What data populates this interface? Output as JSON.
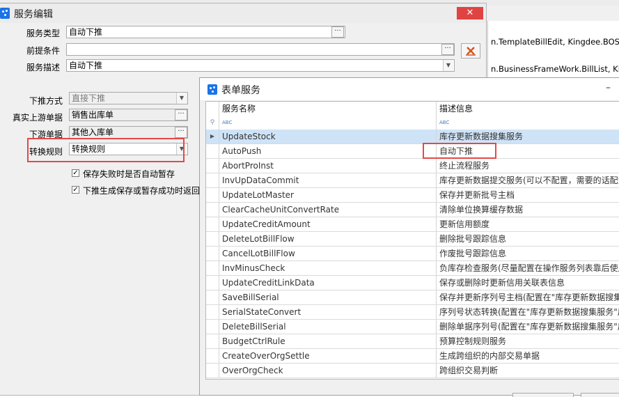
{
  "bg": {
    "line1": "n.TemplateBillEdit, Kingdee.BOS.Bu",
    "line2": "n.BusinessFrameWork.BillList, Kingd"
  },
  "service_edit": {
    "title": "服务编辑",
    "close_icon": "close-x",
    "fields": {
      "service_type": {
        "label": "服务类型",
        "value": "自动下推"
      },
      "precondition": {
        "label": "前提条件",
        "value": ""
      },
      "service_desc": {
        "label": "服务描述",
        "value": "自动下推"
      },
      "push_mode": {
        "label": "下推方式",
        "value": "直接下推"
      },
      "upstream_bill": {
        "label": "真实上游单据",
        "value": "销售出库单"
      },
      "downstream_bill": {
        "label": "下游单据",
        "value": "其他入库单"
      },
      "convert_rule": {
        "label": "转换规则",
        "value": "转换规则"
      }
    },
    "checkboxes": [
      {
        "label": "保存失败时是否自动暂存",
        "checked": true
      },
      {
        "label": "下推生成保存或暂存成功时返回",
        "checked": true
      }
    ]
  },
  "form_service": {
    "title": "表单服务",
    "minimize_label": "–",
    "columns": [
      "服务名称",
      "描述信息"
    ],
    "filter_icons": [
      "filter-icon",
      "abc-icon",
      "abc-icon"
    ],
    "selected_row": 0,
    "rows": [
      {
        "name": "UpdateStock",
        "desc": "库存更新数据搜集服务"
      },
      {
        "name": "AutoPush",
        "desc": "自动下推"
      },
      {
        "name": "AbortProInst",
        "desc": "终止流程服务"
      },
      {
        "name": "InvUpDataCommit",
        "desc": "库存更新数据提交服务(可以不配置，需要的话配置"
      },
      {
        "name": "UpdateLotMaster",
        "desc": "保存并更新批号主档"
      },
      {
        "name": "ClearCacheUnitConvertRate",
        "desc": "清除单位换算缓存数据"
      },
      {
        "name": "UpdateCreditAmount",
        "desc": "更新信用额度"
      },
      {
        "name": "DeleteLotBillFlow",
        "desc": "删除批号跟踪信息"
      },
      {
        "name": "CancelLotBillFlow",
        "desc": "作废批号跟踪信息"
      },
      {
        "name": "InvMinusCheck",
        "desc": "负库存检查服务(尽量配置在操作服务列表靠后使用"
      },
      {
        "name": "UpdateCreditLinkData",
        "desc": "保存或删除时更新信用关联表信息"
      },
      {
        "name": "SaveBillSerial",
        "desc": "保存并更新序列号主档(配置在\"库存更新数据搜集"
      },
      {
        "name": "SerialStateConvert",
        "desc": "序列号状态转换(配置在\"库存更新数据搜集服务\"后"
      },
      {
        "name": "DeleteBillSerial",
        "desc": "删除单据序列号(配置在\"库存更新数据搜集服务\"后"
      },
      {
        "name": "BudgetCtrlRule",
        "desc": "预算控制规则服务"
      },
      {
        "name": "CreateOverOrgSettle",
        "desc": "生成跨组织的内部交易单据"
      },
      {
        "name": "OverOrgCheck",
        "desc": "跨组织交易判断"
      }
    ]
  },
  "colors": {
    "highlight": "#e54848",
    "selected_row": "#cfe3f7",
    "title_icon": "#1a73e8",
    "close_button": "#e04343"
  }
}
